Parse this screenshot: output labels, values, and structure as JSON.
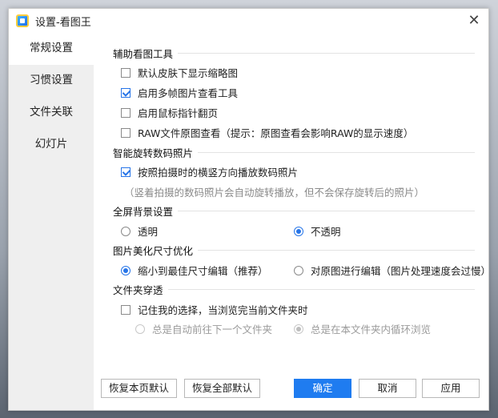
{
  "window": {
    "title": "设置-看图王",
    "close_glyph": "✕"
  },
  "sidebar": {
    "items": [
      {
        "label": "常规设置",
        "active": true
      },
      {
        "label": "习惯设置",
        "active": false
      },
      {
        "label": "文件关联",
        "active": false
      },
      {
        "label": "幻灯片",
        "active": false
      }
    ]
  },
  "sections": {
    "tools": {
      "title": "辅助看图工具",
      "options": [
        {
          "label": "默认皮肤下显示缩略图",
          "checked": false
        },
        {
          "label": "启用多帧图片查看工具",
          "checked": true
        },
        {
          "label": "启用鼠标指针翻页",
          "checked": false
        },
        {
          "label": "RAW文件原图查看（提示：原图查看会影响RAW的显示速度）",
          "checked": false
        }
      ]
    },
    "rotate": {
      "title": "智能旋转数码照片",
      "option": {
        "label": "按照拍摄时的横竖方向播放数码照片",
        "checked": true
      },
      "hint": "（竖着拍摄的数码照片会自动旋转播放，但不会保存旋转后的照片）"
    },
    "background": {
      "title": "全屏背景设置",
      "options": [
        {
          "label": "透明",
          "checked": false
        },
        {
          "label": "不透明",
          "checked": true
        }
      ]
    },
    "resize": {
      "title": "图片美化尺寸优化",
      "options": [
        {
          "label": "缩小到最佳尺寸编辑（推荐）",
          "checked": true
        },
        {
          "label": "对原图进行编辑（图片处理速度会过慢）",
          "checked": false
        }
      ]
    },
    "folder": {
      "title": "文件夹穿透",
      "option": {
        "label": "记住我的选择，当浏览完当前文件夹时",
        "checked": false
      },
      "sub_options": [
        {
          "label": "总是自动前往下一个文件夹",
          "checked": false
        },
        {
          "label": "总是在本文件夹内循环浏览",
          "checked": true
        }
      ]
    }
  },
  "buttons": {
    "restore_page": "恢复本页默认",
    "restore_all": "恢复全部默认",
    "ok": "确定",
    "cancel": "取消",
    "apply": "应用"
  },
  "colors": {
    "accent": "#1f7cf0"
  }
}
